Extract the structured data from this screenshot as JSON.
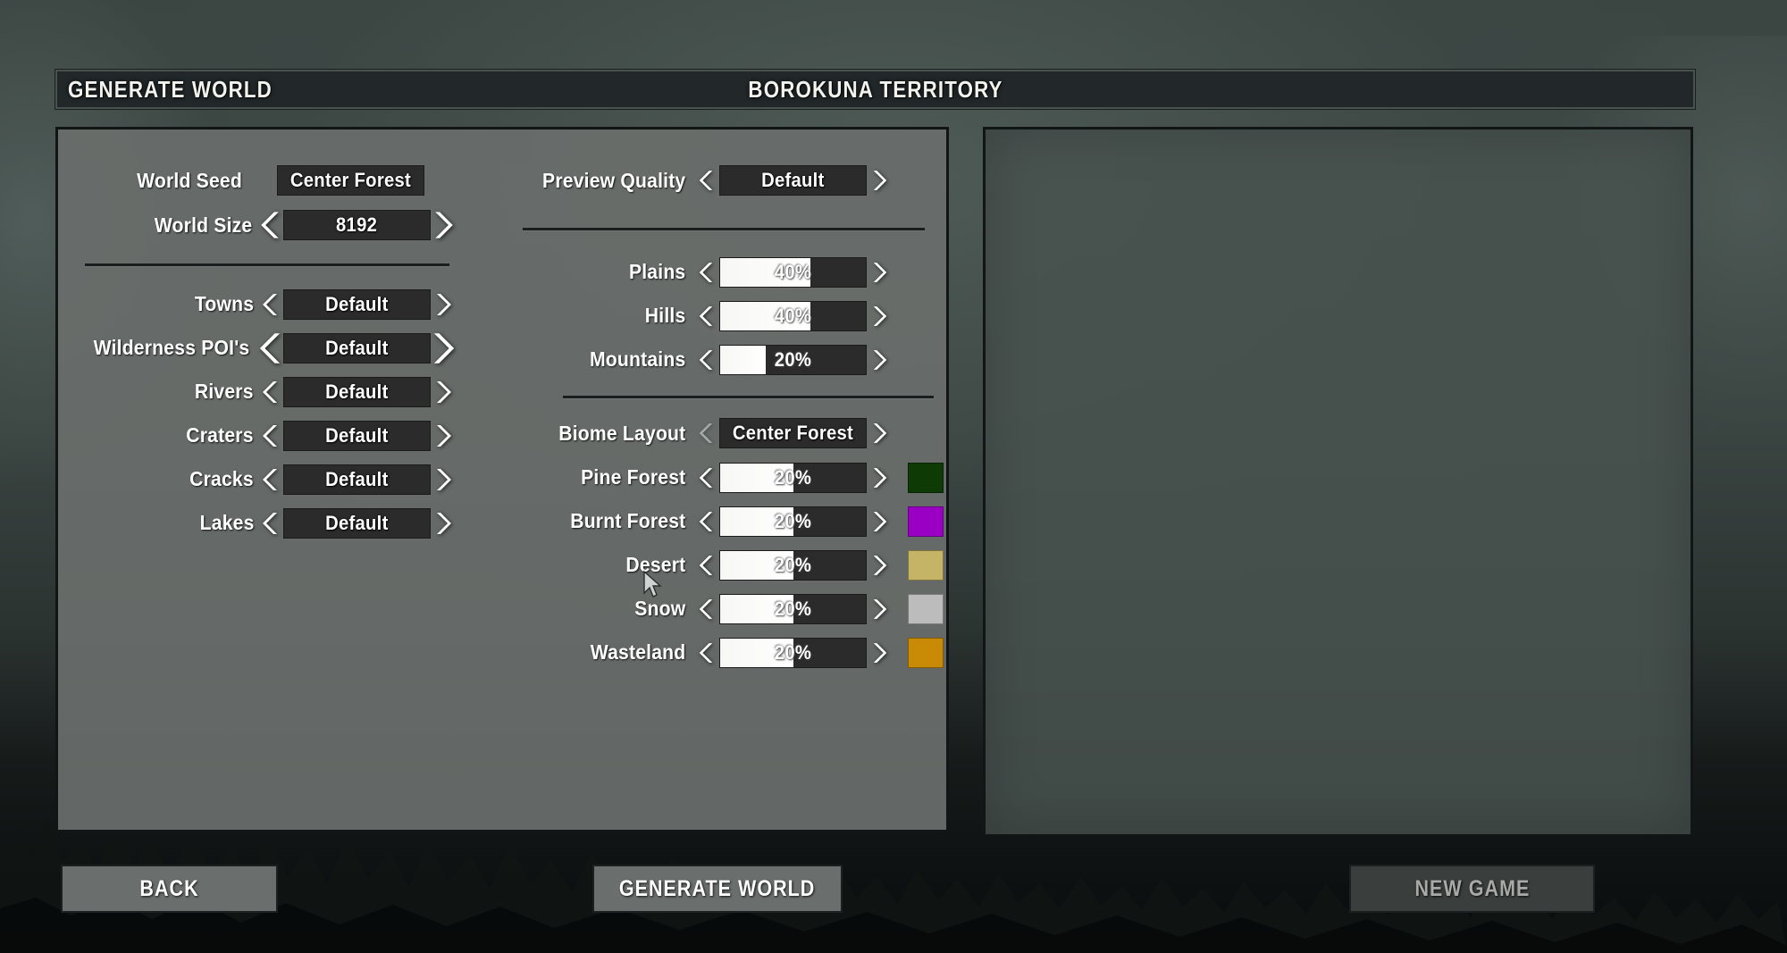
{
  "header": {
    "left_title": "GENERATE WORLD",
    "center_title": "BOROKUNA TERRITORY"
  },
  "colors": {
    "panel_bg": "#696e6c",
    "value_bg": "#2b2b2b",
    "fill": "#ffffff",
    "text": "#ffffff",
    "frame": "#121515"
  },
  "left_column": {
    "top_rows": [
      {
        "label": "World Seed",
        "value": "Center Forest",
        "has_arrows": false,
        "type": "text"
      },
      {
        "label": "World Size",
        "value": "8192",
        "has_arrows": true,
        "type": "stepper"
      }
    ],
    "feature_rows": [
      {
        "label": "Towns",
        "value": "Default",
        "type": "stepper"
      },
      {
        "label": "Wilderness POI's",
        "value": "Default",
        "type": "stepper",
        "hover": true
      },
      {
        "label": "Rivers",
        "value": "Default",
        "type": "stepper"
      },
      {
        "label": "Craters",
        "value": "Default",
        "type": "stepper"
      },
      {
        "label": "Cracks",
        "value": "Default",
        "type": "stepper"
      },
      {
        "label": "Lakes",
        "value": "Default",
        "type": "stepper"
      }
    ]
  },
  "right_column": {
    "preview_quality": {
      "label": "Preview Quality",
      "value": "Default",
      "type": "stepper"
    },
    "terrain_rows": [
      {
        "label": "Plains",
        "value": "40%",
        "percent": 40,
        "fill_ratio": 0.62,
        "type": "slider"
      },
      {
        "label": "Hills",
        "value": "40%",
        "percent": 40,
        "fill_ratio": 0.62,
        "type": "slider"
      },
      {
        "label": "Mountains",
        "value": "20%",
        "percent": 20,
        "fill_ratio": 0.31,
        "type": "slider"
      }
    ],
    "biome_layout": {
      "label": "Biome Layout",
      "value": "Center Forest",
      "type": "stepper",
      "left_arrow_disabled": true
    },
    "biome_rows": [
      {
        "label": "Pine Forest",
        "value": "20%",
        "percent": 20,
        "fill_ratio": 0.5,
        "color": "#0d3a05",
        "type": "slider"
      },
      {
        "label": "Burnt Forest",
        "value": "20%",
        "percent": 20,
        "fill_ratio": 0.5,
        "color": "#9a00c4",
        "type": "slider"
      },
      {
        "label": "Desert",
        "value": "20%",
        "percent": 20,
        "fill_ratio": 0.5,
        "color": "#c5b466",
        "type": "slider"
      },
      {
        "label": "Snow",
        "value": "20%",
        "percent": 20,
        "fill_ratio": 0.5,
        "color": "#bcbcbc",
        "type": "slider"
      },
      {
        "label": "Wasteland",
        "value": "20%",
        "percent": 20,
        "fill_ratio": 0.5,
        "color": "#c98a05",
        "type": "slider"
      }
    ]
  },
  "preview": {
    "content": ""
  },
  "footer": {
    "back": "BACK",
    "generate": "GENERATE WORLD",
    "new_game": "NEW GAME",
    "new_game_disabled": true
  }
}
